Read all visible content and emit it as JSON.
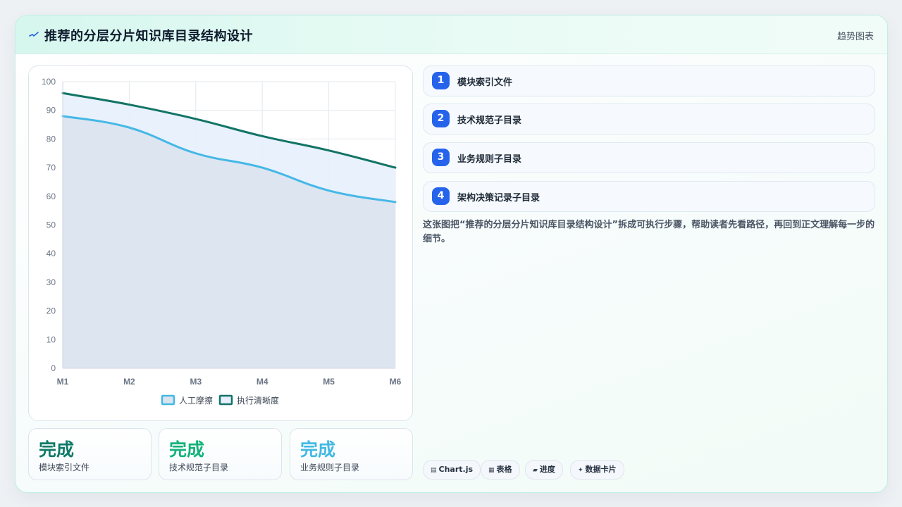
{
  "header": {
    "title": "推荐的分层分片知识库目录结构设计",
    "right_label": "趋势图表",
    "icon": "trend-pulse-icon"
  },
  "chart_data": {
    "type": "area",
    "categories": [
      "M1",
      "M2",
      "M3",
      "M4",
      "M5",
      "M6"
    ],
    "series": [
      {
        "name": "人工摩擦",
        "values": [
          88,
          84,
          75,
          70,
          62,
          58
        ],
        "stroke": "#45b8e6",
        "fill": "#dbe3ef"
      },
      {
        "name": "执行清晰度",
        "values": [
          96,
          92,
          87,
          81,
          76,
          70
        ],
        "stroke": "#127466",
        "fill": "#e7effc"
      }
    ],
    "ylim": [
      0,
      100
    ],
    "yticks": [
      0,
      10,
      20,
      30,
      40,
      50,
      60,
      70,
      80,
      90,
      100
    ],
    "grid": true,
    "legend_position": "bottom"
  },
  "stats": [
    {
      "value": "完成",
      "label": "模块索引文件",
      "color": "#0f7a67"
    },
    {
      "value": "完成",
      "label": "技术规范子目录",
      "color": "#14b27a"
    },
    {
      "value": "完成",
      "label": "业务规则子目录",
      "color": "#43b9e3"
    }
  ],
  "steps": [
    {
      "num": "1",
      "label": "模块索引文件"
    },
    {
      "num": "2",
      "label": "技术规范子目录"
    },
    {
      "num": "3",
      "label": "业务规则子目录"
    },
    {
      "num": "4",
      "label": "架构决策记录子目录"
    }
  ],
  "description": "这张图把“推荐的分层分片知识库目录结构设计”拆成可执行步骤，帮助读者先看路径，再回到正文理解每一步的细节。",
  "tags": [
    {
      "icon": "▤",
      "label": "Chart.js"
    },
    {
      "icon": "▦",
      "label": "表格"
    },
    {
      "icon": "▰",
      "label": "进度"
    },
    {
      "icon": "✦",
      "label": "数据卡片"
    }
  ]
}
